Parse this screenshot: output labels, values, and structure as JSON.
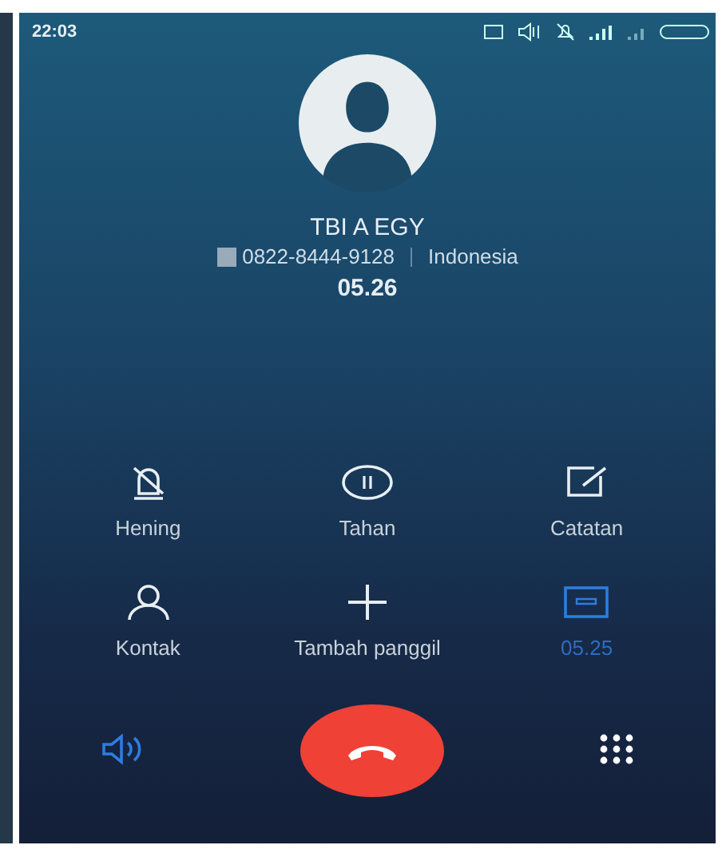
{
  "status_bar": {
    "time": "22:03"
  },
  "caller": {
    "name": "TBI A EGY",
    "number": "0822-8444-9128",
    "region": "Indonesia",
    "duration": "05.26"
  },
  "actions": [
    {
      "kind": "mute",
      "label": "Hening",
      "on": false
    },
    {
      "kind": "hold",
      "label": "Tahan",
      "on": false
    },
    {
      "kind": "note",
      "label": "Catatan",
      "on": false
    },
    {
      "kind": "contact",
      "label": "Kontak",
      "on": false
    },
    {
      "kind": "add",
      "label": "Tambah panggil",
      "on": false
    },
    {
      "kind": "record",
      "label": "05.25",
      "on": true
    }
  ],
  "bottom": {
    "speaker_on": true
  }
}
